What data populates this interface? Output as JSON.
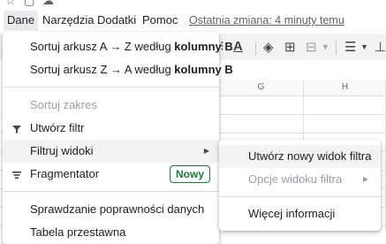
{
  "menubar": {
    "items": [
      "Dane",
      "Narzędzia",
      "Dodatki",
      "Pomoc"
    ],
    "last_edit": "Ostatnia zmiana: 4 minuty temu"
  },
  "top_icons": [
    "star-icon",
    "move-icon",
    "cloud-icon"
  ],
  "toolbar": {
    "icons": [
      "text-color-icon",
      "fill-color-icon",
      "borders-icon",
      "merge-cells-icon",
      "align-icon"
    ]
  },
  "grid": {
    "columns": [
      "G",
      "H"
    ]
  },
  "dane_menu": {
    "sort_az_prefix": "Sortuj arkusz A → Z według ",
    "sort_az_bold": "kolumny B",
    "sort_za_prefix": "Sortuj arkusz Z → A według ",
    "sort_za_bold": "kolumny B",
    "sort_range": "Sortuj zakres",
    "create_filter": "Utwórz filtr",
    "filter_views": "Filtruj widoki",
    "slicer": "Fragmentator",
    "slicer_badge": "Nowy",
    "data_validation": "Sprawdzanie poprawności danych",
    "pivot_table": "Tabela przestawna"
  },
  "filter_views_submenu": {
    "create_new": "Utwórz nowy widok filtra",
    "options": "Opcje widoku filtra",
    "more_info": "Więcej informacji"
  }
}
